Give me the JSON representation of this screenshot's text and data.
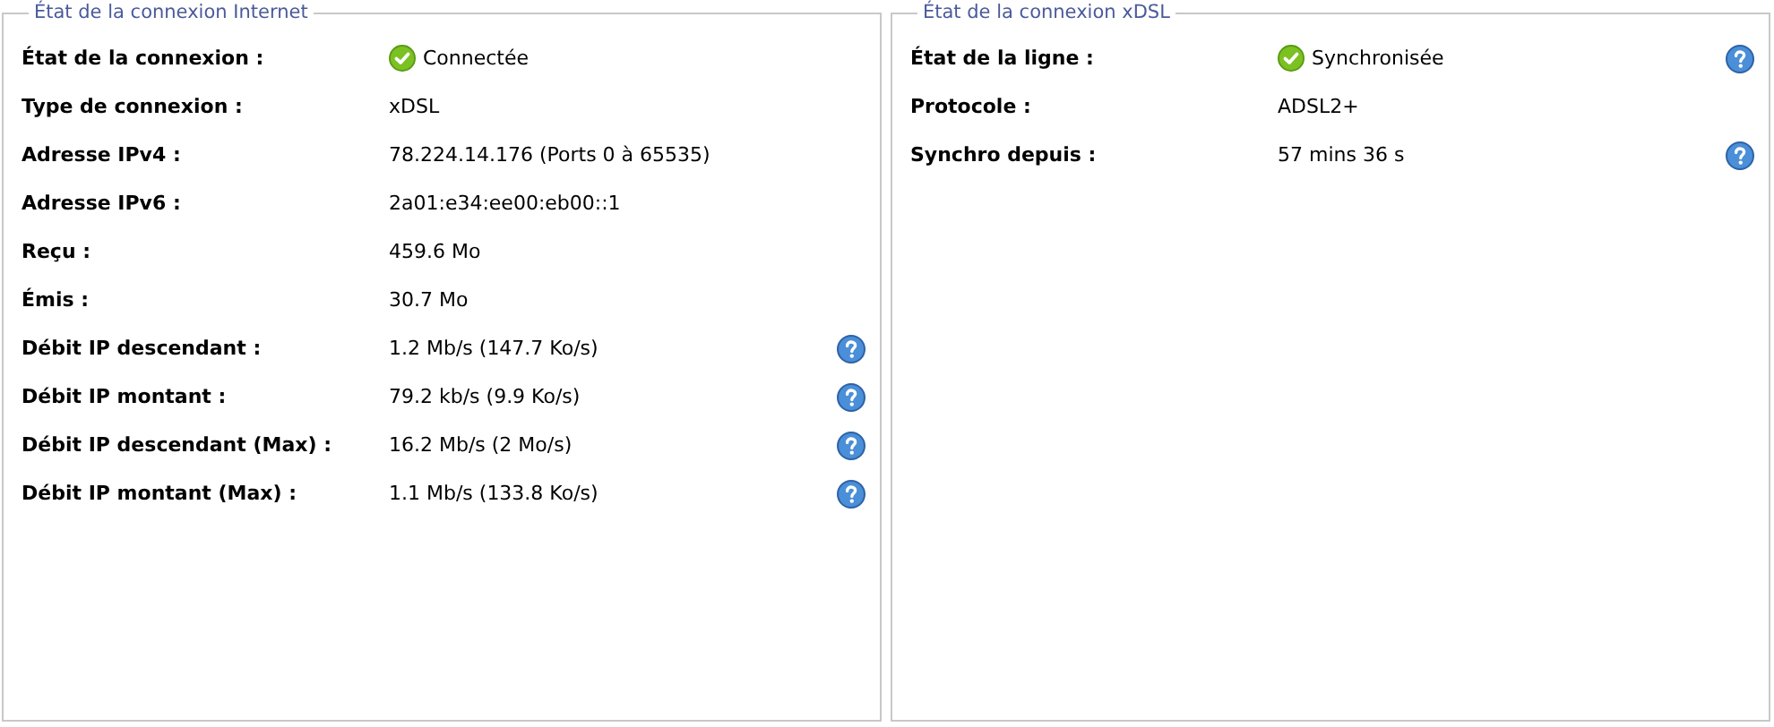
{
  "panels": [
    {
      "title": "État de la connexion Internet",
      "rows": [
        {
          "label": "État de la connexion :",
          "value": "Connectée",
          "ok": true,
          "help": false
        },
        {
          "label": "Type de connexion :",
          "value": "xDSL",
          "ok": false,
          "help": false
        },
        {
          "label": "Adresse IPv4 :",
          "value": "78.224.14.176 (Ports 0 à 65535)",
          "ok": false,
          "help": false
        },
        {
          "label": "Adresse IPv6 :",
          "value": "2a01:e34:ee00:eb00::1",
          "ok": false,
          "help": false
        },
        {
          "label": "Reçu :",
          "value": "459.6 Mo",
          "ok": false,
          "help": false
        },
        {
          "label": "Émis :",
          "value": "30.7 Mo",
          "ok": false,
          "help": false
        },
        {
          "label": "Débit IP descendant :",
          "value": "1.2 Mb/s (147.7 Ko/s)",
          "ok": false,
          "help": true
        },
        {
          "label": "Débit IP montant :",
          "value": "79.2 kb/s (9.9 Ko/s)",
          "ok": false,
          "help": true
        },
        {
          "label": "Débit IP descendant (Max) :",
          "value": "16.2 Mb/s (2 Mo/s)",
          "ok": false,
          "help": true
        },
        {
          "label": "Débit IP montant (Max) :",
          "value": "1.1 Mb/s (133.8 Ko/s)",
          "ok": false,
          "help": true
        }
      ]
    },
    {
      "title": "État de la connexion xDSL",
      "rows": [
        {
          "label": "État de la ligne :",
          "value": "Synchronisée",
          "ok": true,
          "help": true
        },
        {
          "label": "Protocole :",
          "value": "ADSL2+",
          "ok": false,
          "help": false
        },
        {
          "label": "Synchro depuis :",
          "value": "57 mins 36 s",
          "ok": false,
          "help": true
        }
      ]
    }
  ]
}
